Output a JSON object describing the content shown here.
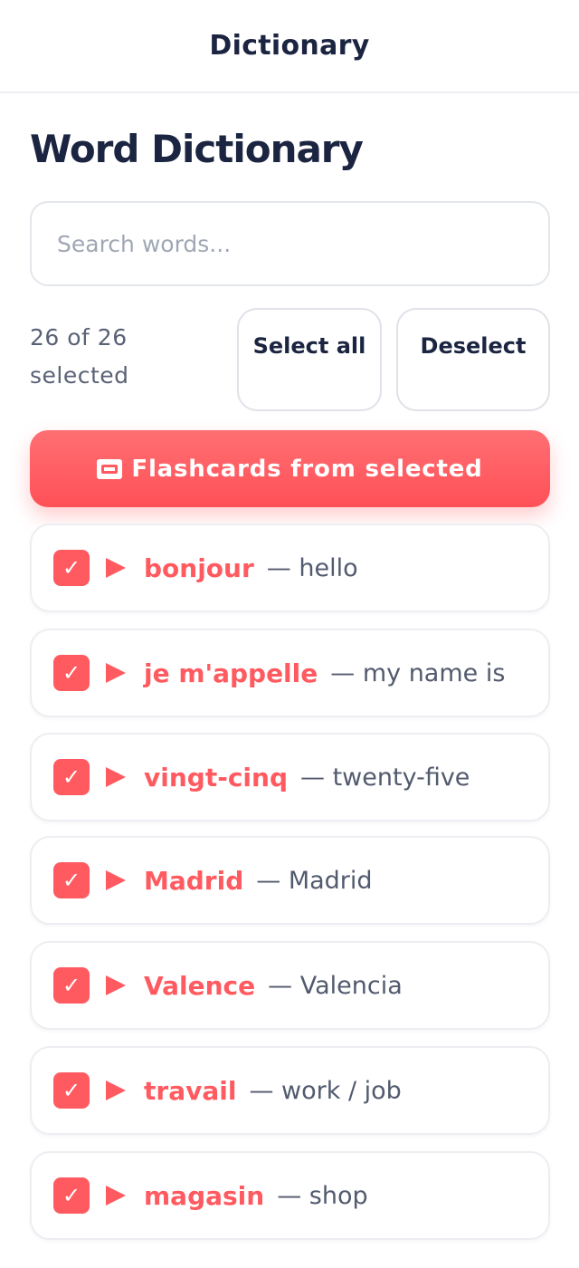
{
  "header": {
    "title": "Dictionary"
  },
  "page": {
    "title": "Word Dictionary"
  },
  "search": {
    "placeholder": "Search words...",
    "value": ""
  },
  "selection": {
    "count_text": "26 of 26 selected",
    "select_all_label": "Select all",
    "deselect_label": "Deselect"
  },
  "flashcards": {
    "label": "Flashcards from selected",
    "icon": "flashcard-icon"
  },
  "words": [
    {
      "term": "bonjour",
      "meaning": "— hello",
      "checked": true
    },
    {
      "term": "je m'appelle",
      "meaning": "— my name is",
      "checked": true
    },
    {
      "term": "vingt-cinq",
      "meaning": "— twenty-five",
      "checked": true
    },
    {
      "term": "Madrid",
      "meaning": "— Madrid",
      "checked": true
    },
    {
      "term": "Valence",
      "meaning": "— Valencia",
      "checked": true
    },
    {
      "term": "travail",
      "meaning": "— work / job",
      "checked": true
    },
    {
      "term": "magasin",
      "meaning": "— shop",
      "checked": true
    }
  ],
  "colors": {
    "accent": "#ff5a60",
    "title": "#1b2440",
    "muted": "#5a6275"
  }
}
